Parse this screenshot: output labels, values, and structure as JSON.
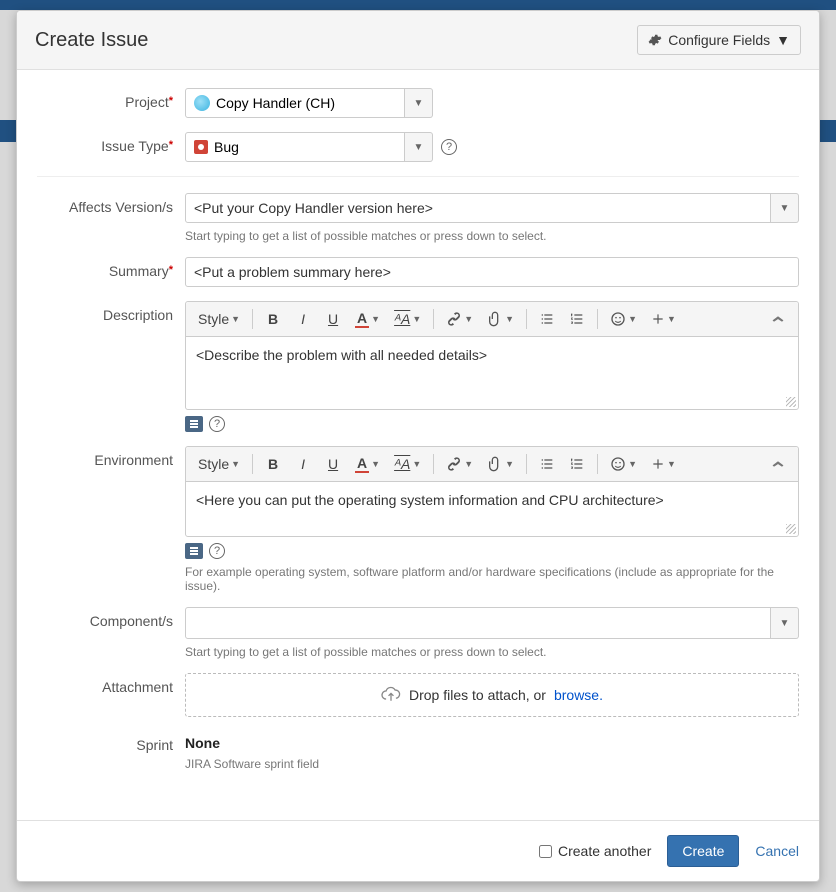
{
  "header": {
    "title": "Create Issue",
    "configure_label": "Configure Fields"
  },
  "labels": {
    "project": "Project",
    "issue_type": "Issue Type",
    "affects": "Affects Version/s",
    "summary": "Summary",
    "description": "Description",
    "environment": "Environment",
    "components": "Component/s",
    "attachment": "Attachment",
    "sprint": "Sprint"
  },
  "project": {
    "value": "Copy Handler (CH)"
  },
  "issue_type": {
    "value": "Bug"
  },
  "affects": {
    "placeholder": "<Put your Copy Handler version here>",
    "hint": "Start typing to get a list of possible matches or press down to select."
  },
  "summary": {
    "value": "<Put a problem summary here>"
  },
  "description": {
    "value": "<Describe the problem with all needed details>"
  },
  "environment": {
    "value": "<Here you can put the operating system information and CPU architecture>",
    "hint": "For example operating system, software platform and/or hardware specifications (include as appropriate for the issue)."
  },
  "components": {
    "hint": "Start typing to get a list of possible matches or press down to select."
  },
  "attachment": {
    "drop_text": "Drop files to attach, or",
    "browse": "browse"
  },
  "sprint": {
    "value": "None",
    "hint": "JIRA Software sprint field"
  },
  "rte_toolbar": {
    "style": "Style"
  },
  "footer": {
    "create_another": "Create another",
    "create": "Create",
    "cancel": "Cancel"
  }
}
